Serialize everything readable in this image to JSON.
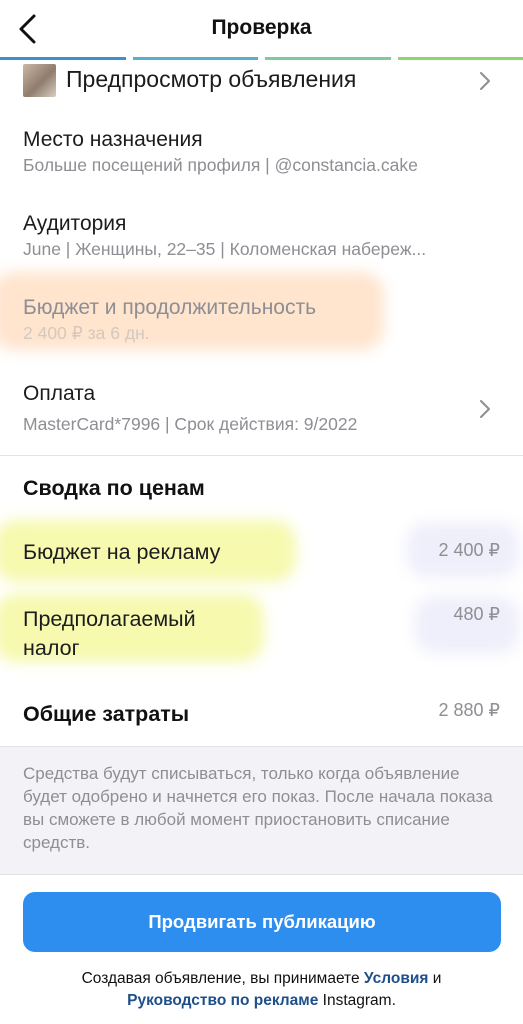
{
  "header": {
    "title": "Проверка",
    "back_icon": "chevron-left-icon"
  },
  "progress": {
    "colors": [
      "#3a90d6",
      "#55b0c8",
      "#7ccba0",
      "#8ad86c"
    ]
  },
  "preview": {
    "label": "Предпросмотр объявления"
  },
  "destination": {
    "title": "Место назначения",
    "subtitle": "Больше посещений профиля | @constancia.cake"
  },
  "audience": {
    "title": "Аудитория",
    "subtitle": "June | Женщины,  22–35 | Коломенская набереж..."
  },
  "budget": {
    "title": "Бюджет и продолжительность",
    "subtitle": "2 400 ₽ за 6 дн."
  },
  "payment": {
    "title": "Оплата",
    "subtitle": "MasterCard*7996 | Срок действия: 9/2022"
  },
  "summary": {
    "title": "Сводка по ценам",
    "ad_budget_label": "Бюджет на рекламу",
    "ad_budget_value": "2 400 ₽",
    "tax_label_line1": "Предполагаемый",
    "tax_label_line2": "налог",
    "tax_value": "480 ₽",
    "total_label": "Общие затраты",
    "total_value": "2 880 ₽"
  },
  "notice": {
    "text": "Средства будут списываться, только когда объявление будет одобрено и начнется его показ. После начала показа вы сможете в любой момент приостановить списание средств."
  },
  "footer": {
    "button_label": "Продвигать публикацию",
    "terms_prefix": "Создавая объявление, вы принимаете ",
    "terms_link": "Условия",
    "terms_and": " и",
    "guidelines_link": "Руководство по рекламе",
    "terms_suffix": " Instagram."
  }
}
